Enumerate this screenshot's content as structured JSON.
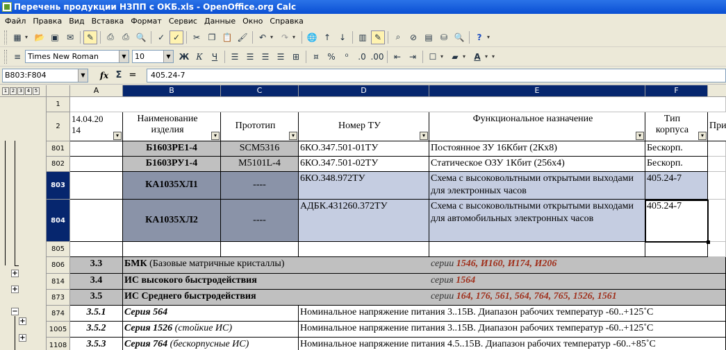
{
  "window": {
    "title": "Перечень продукции НЗПП с ОКБ.xls - OpenOffice.org Calc"
  },
  "menu": [
    "Файл",
    "Правка",
    "Вид",
    "Вставка",
    "Формат",
    "Сервис",
    "Данные",
    "Окно",
    "Справка"
  ],
  "format_toolbar": {
    "font": "Times New Roman",
    "size": "10",
    "bold": "Ж",
    "italic": "К",
    "underline": "Ч"
  },
  "formula_bar": {
    "name_box": "B803:F804",
    "fx": "fx",
    "sigma": "Σ",
    "equals": "=",
    "content": "405.24-7"
  },
  "outline_levels": [
    "1",
    "2",
    "3",
    "4",
    "5"
  ],
  "columns": [
    "A",
    "B",
    "C",
    "D",
    "E",
    "F"
  ],
  "header_row": {
    "a": "14.04.20 14",
    "b": "Наименование изделия",
    "c": "Прототип",
    "d": "Номер ТУ",
    "e": "Функциональное назначение",
    "f": "Тип корпуса",
    "g": "При"
  },
  "rows": {
    "r801": {
      "num": "801",
      "b": "Б1603РЕ1-4",
      "c": "SCM5316",
      "d": "6КО.347.501-01ТУ",
      "e": "Постоянное ЗУ 16Кбит (2Кх8)",
      "f": "Бескорп."
    },
    "r802": {
      "num": "802",
      "b": "Б1603РУ1-4",
      "c": "M5101L-4",
      "d": "6КО.347.501-02ТУ",
      "e": "Статическое ОЗУ 1Кбит (256х4)",
      "f": "Бескорп."
    },
    "r803": {
      "num": "803",
      "b": "КА1035ХЛ1",
      "c": "----",
      "d": "6КО.348.972ТУ",
      "e": "Схема с высоковольтными открытыми выходами для электронных часов",
      "f": "405.24-7"
    },
    "r804": {
      "num": "804",
      "b": "КА1035ХЛ2",
      "c": "----",
      "d": "АДБК.431260.372ТУ",
      "e": "Схема с высоковольтными открытыми выходами для автомобильных электронных часов",
      "f": "405.24-7"
    },
    "r805": {
      "num": "805"
    },
    "r806": {
      "num": "806",
      "a": "3.3",
      "b_bold": "БМК",
      "b_rest": " (Базовые матричные кристаллы)",
      "e_word": "серии",
      "e_series": " 1546, И160, И174, И206"
    },
    "r814": {
      "num": "814",
      "a": "3.4",
      "b_bold": "ИС высокого быстродействия",
      "e_word": "серия",
      "e_series": " 1564"
    },
    "r873": {
      "num": "873",
      "a": "3.5",
      "b_bold": "ИС Среднего быстродействия",
      "e_word": "серии",
      "e_series": " 164, 176, 561, 564, 764, 765, 1526, 1561"
    },
    "r874": {
      "num": "874",
      "a": "3.5.1",
      "b_bold": "Серия 564",
      "b_rest": "",
      "d": "Номинальное напряжение питания 3..15В. Диапазон рабочих температур -60..+125˚С"
    },
    "r1005": {
      "num": "1005",
      "a": "3.5.2",
      "b_bold": "Серия 1526",
      "b_rest": " (стойкие ИС)",
      "d": "Номинальное напряжение питания 3..15В. Диапазон рабочих температур -60..+125˚С"
    },
    "r1108": {
      "num": "1108",
      "a": "3.5.3",
      "b_bold": "Серия 764",
      "b_rest": " (бескорпусные ИС)",
      "d": "Номинальное напряжение питания 4.5..15В. Диапазон рабочих температур -60..+85˚С"
    }
  },
  "colors": {
    "selection": "#c5cde1",
    "header_selected": "#06266e",
    "series_text": "#a0301c",
    "gray_band": "#c0c0c0"
  }
}
